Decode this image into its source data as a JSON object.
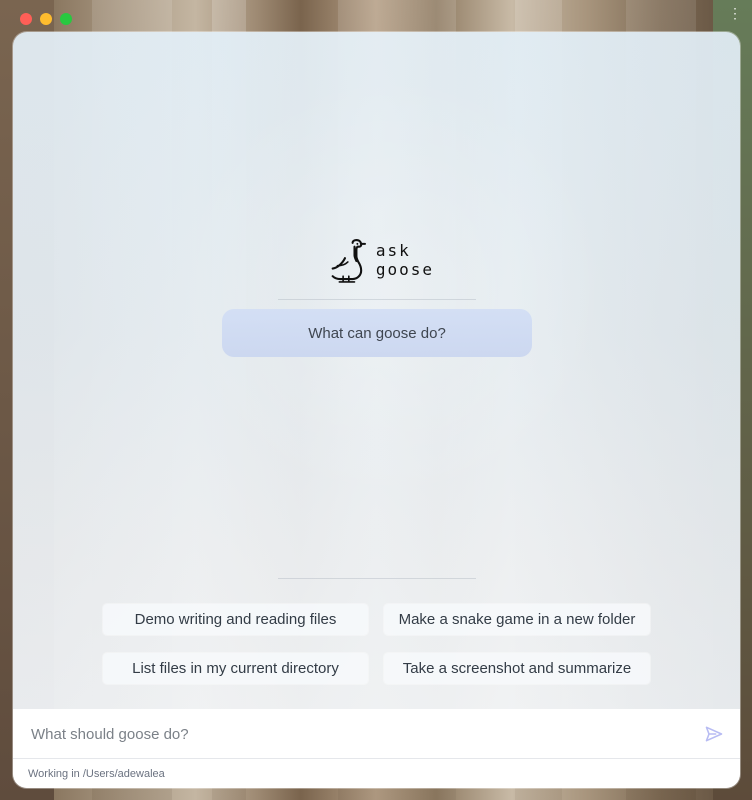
{
  "window": {
    "controls": [
      "close",
      "minimize",
      "zoom"
    ],
    "menu_icon": "vertical-ellipsis-icon"
  },
  "logo": {
    "line1": "ask",
    "line2": "goose"
  },
  "hero_prompt": "What can goose do?",
  "suggestions": [
    "Demo writing and reading files",
    "Make a snake game in a new folder",
    "List files in my current directory",
    "Take a screenshot and summarize"
  ],
  "composer": {
    "placeholder": "What should goose do?",
    "working_dir": "Working in /Users/adewalea",
    "send_icon": "send-icon"
  },
  "colors": {
    "close": "#ff5f57",
    "minimize": "#febc2e",
    "zoom": "#28c840",
    "hero_chip": "#d3def4",
    "send_icon": "#b8bcf3"
  }
}
